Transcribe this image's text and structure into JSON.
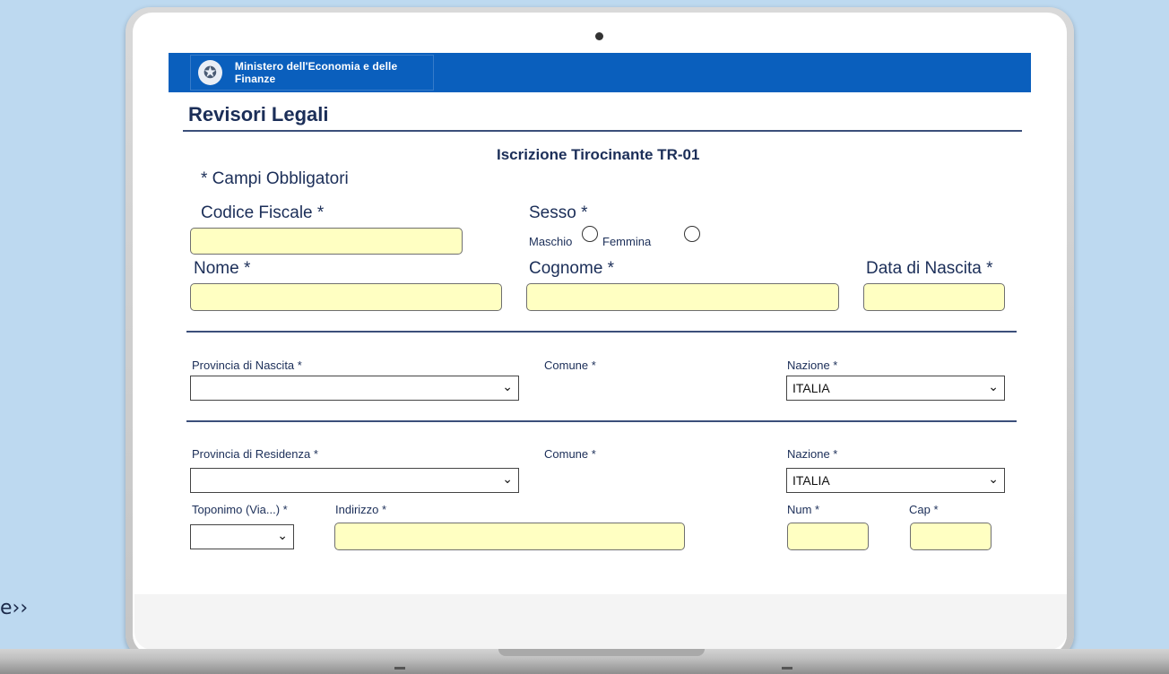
{
  "page": {
    "edge_text": "e››"
  },
  "header": {
    "ministry": "Ministero dell'Economia e delle Finanze"
  },
  "app": {
    "title": "Revisori Legali"
  },
  "form": {
    "title": "Iscrizione Tirocinante TR-01",
    "required_note": "* Campi Obbligatori",
    "codice_fiscale_label": "Codice Fiscale *",
    "sesso_label": "Sesso *",
    "maschio_label": "Maschio",
    "femmina_label": "Femmina",
    "nome_label": "Nome *",
    "cognome_label": "Cognome *",
    "data_nascita_label": "Data di Nascita *",
    "provincia_nascita_label": "Provincia di Nascita *",
    "comune_nascita_label": "Comune *",
    "nazione_nascita_label": "Nazione *",
    "nazione_nascita_value": "ITALIA",
    "provincia_residenza_label": "Provincia di Residenza *",
    "comune_residenza_label": "Comune *",
    "nazione_residenza_label": "Nazione *",
    "nazione_residenza_value": "ITALIA",
    "toponimo_label": "Toponimo (Via...) *",
    "indirizzo_label": "Indirizzo *",
    "num_label": "Num *",
    "cap_label": "Cap *"
  },
  "icons": {
    "emblem": "italian-republic-emblem-icon",
    "dropdown": "chevron-down-icon",
    "radio": "radio-unchecked-icon"
  }
}
